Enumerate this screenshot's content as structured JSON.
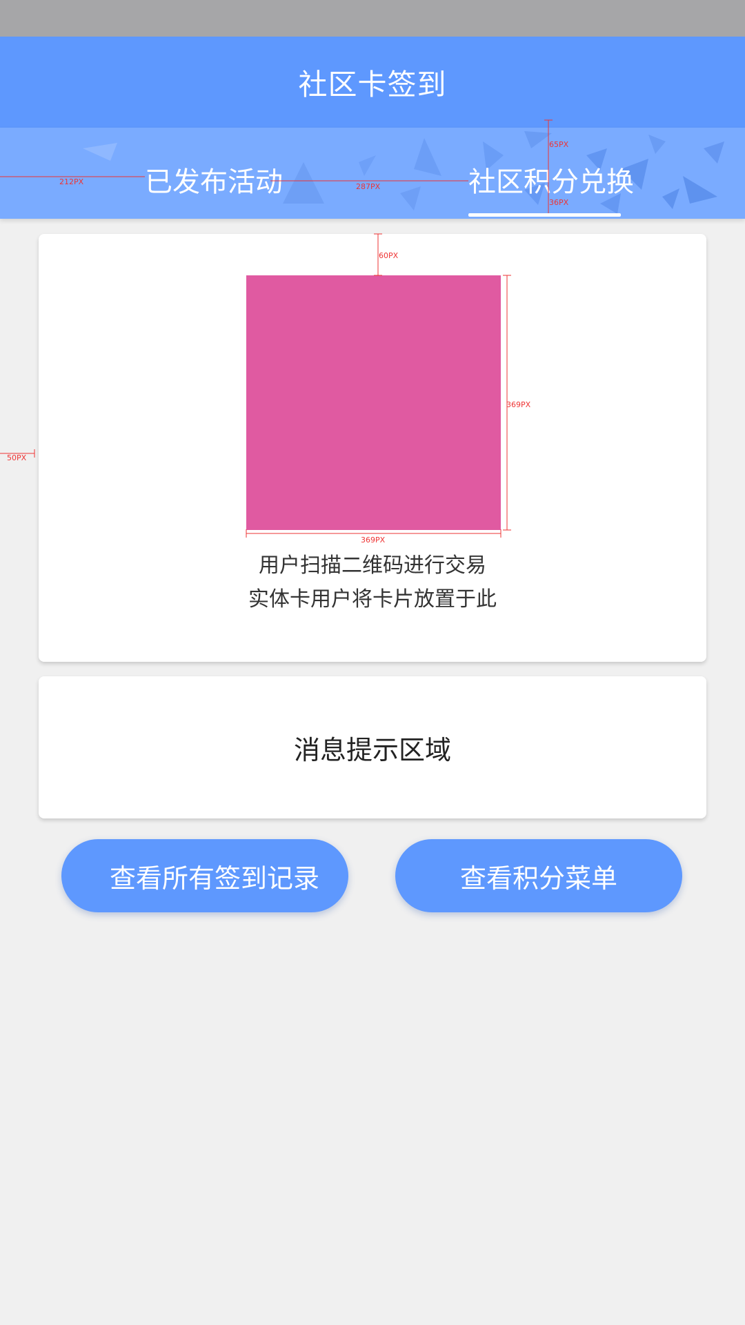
{
  "header": {
    "title": "社区卡签到"
  },
  "tabs": [
    {
      "label": "已发布活动",
      "selected": false
    },
    {
      "label": "社区积分兑换",
      "selected": true
    }
  ],
  "scan_card": {
    "hint_line_1": "用户扫描二维码进行交易",
    "hint_line_2": "实体卡用户将卡片放置于此"
  },
  "message_card": {
    "text": "消息提示区域"
  },
  "buttons": {
    "view_records": "查看所有签到记录",
    "view_points_menu": "查看积分菜单"
  },
  "annotations": {
    "tab_left_margin": "212PX",
    "tab_gap": "287PX",
    "tab_top": "65PX",
    "tab_bottom": "36PX",
    "qr_top": "60PX",
    "qr_height": "369PX",
    "qr_width": "369PX",
    "card_margin": "50PX"
  },
  "colors": {
    "primary": "#5e98fe",
    "tab_bar": "#7aabff",
    "qr_placeholder": "#e05aa1",
    "annotation": "#ee3333"
  }
}
